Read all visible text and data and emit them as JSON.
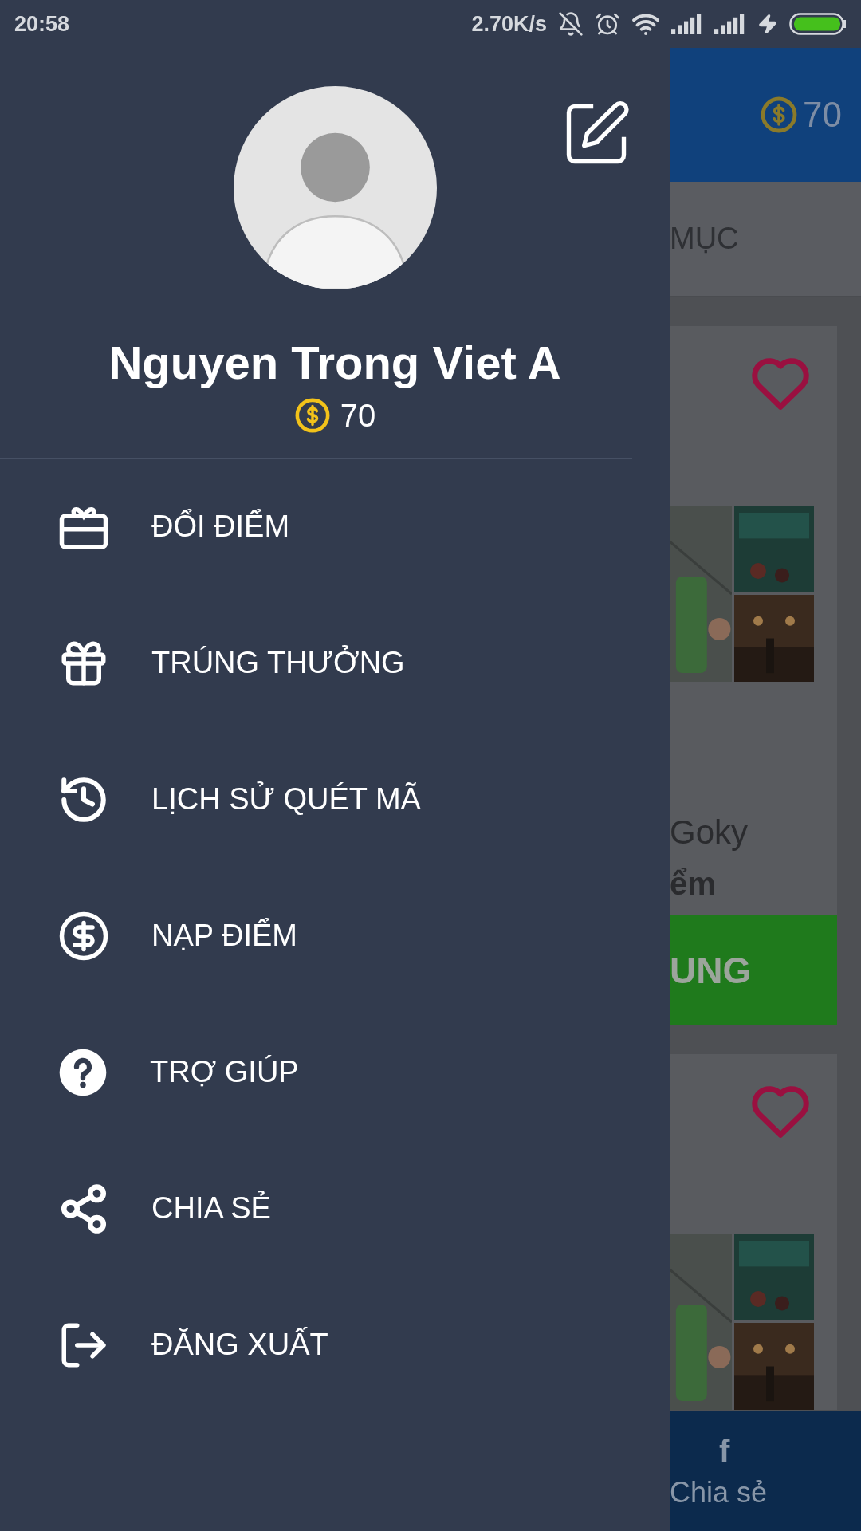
{
  "status_bar": {
    "time": "20:58",
    "network_speed": "2.70K/s"
  },
  "drawer": {
    "profile": {
      "name": "Nguyen Trong Viet A",
      "points": "70"
    },
    "menu": [
      {
        "label": "ĐỔI ĐIỂM"
      },
      {
        "label": "TRÚNG THƯỞNG"
      },
      {
        "label": "LỊCH SỬ QUÉT MÃ"
      },
      {
        "label": "NẠP ĐIỂM"
      },
      {
        "label": "TRỢ GIÚP"
      },
      {
        "label": "CHIA SẺ"
      },
      {
        "label": "ĐĂNG XUẤT"
      }
    ]
  },
  "background": {
    "app_bar": {
      "points": "70"
    },
    "tab": {
      "label": "MỤC"
    },
    "cards": [
      {
        "kind": "full",
        "title": "Goky",
        "subtitle": "ểm",
        "button": "UNG"
      },
      {
        "kind": "photos"
      }
    ],
    "bottom_nav": {
      "icon": "f",
      "label": "Chia sẻ"
    }
  }
}
